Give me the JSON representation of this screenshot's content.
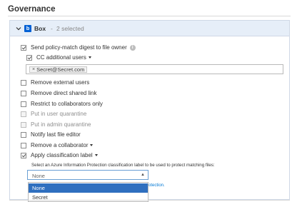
{
  "section": {
    "title": "Governance"
  },
  "panel": {
    "name": "Box",
    "separator": "-",
    "count": "2 selected"
  },
  "options": {
    "send_digest": "Send policy-match digest to file owner",
    "cc_users": "CC additional users",
    "email_tag": "Secret@Secret.com",
    "remove_external": "Remove external users",
    "remove_shared_link": "Remove direct shared link",
    "restrict_collaborators": "Restrict to collaborators only",
    "user_quarantine": "Put in user quarantine",
    "admin_quarantine": "Put in admin quarantine",
    "notify_editor": "Notify last file editor",
    "remove_collaborator": "Remove a collaborator",
    "apply_label": "Apply classification label"
  },
  "classification": {
    "hint": "Select an Azure Information Protection classification label to be used to protect matching files:",
    "selected_value": "None",
    "help_link_fragment": "otection.",
    "dropdown_options": [
      "None",
      "Secret"
    ],
    "highlighted_option": "None"
  },
  "colors": {
    "header_bg": "#e6eef8",
    "box_brand": "#0061d5",
    "selected_option_bg": "#2f6fbf",
    "link": "#0078d4"
  },
  "icons": {
    "collapse": "chevron-down-icon",
    "brand": "box-logo-icon",
    "info": "info-icon",
    "remove_tag": "close-icon"
  }
}
